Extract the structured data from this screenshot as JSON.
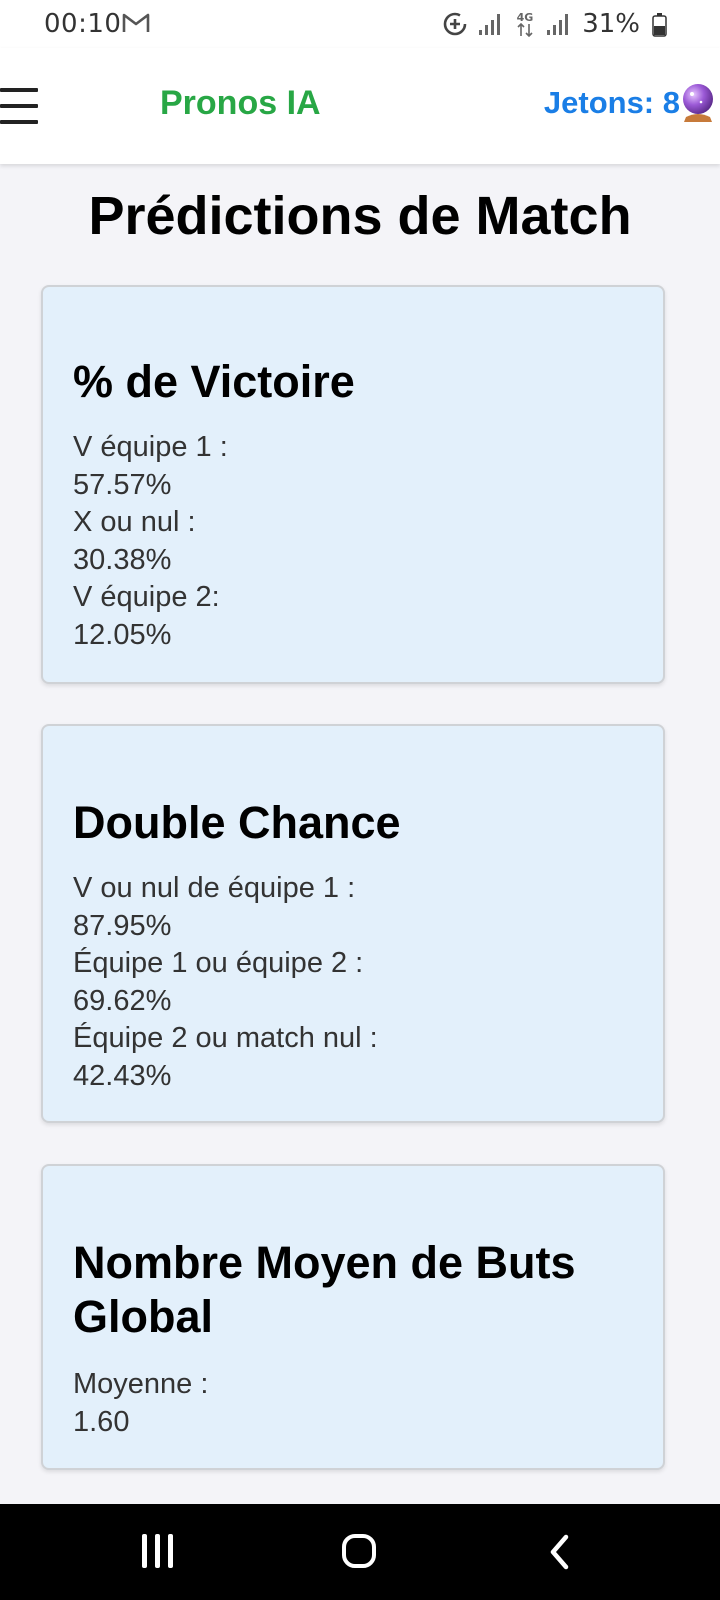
{
  "status_bar": {
    "time": "00:10",
    "battery_percent": "31%",
    "network_label": "4G",
    "icons": [
      "gmail-icon",
      "data-saver-icon",
      "signal-icon",
      "network-4g-icon",
      "signal-icon",
      "battery-icon"
    ]
  },
  "header": {
    "title": "Pronos IA",
    "tokens_label": "Jetons: 8",
    "menu_icon": "hamburger-menu-icon",
    "tokens_icon": "crystal-ball-icon",
    "title_color": "#28a745",
    "tokens_color": "#1a7ee6"
  },
  "page": {
    "title": "Prédictions de Match"
  },
  "cards": [
    {
      "title": "% de Victoire",
      "lines": [
        "V équipe 1 :",
        "57.57%",
        "X ou nul :",
        "30.38%",
        "V équipe 2:",
        "12.05%"
      ]
    },
    {
      "title": "Double Chance",
      "lines": [
        "V ou nul de équipe 1 :",
        "87.95%",
        "Équipe 1 ou équipe 2 :",
        "69.62%",
        "Équipe 2 ou match nul :",
        "42.43%"
      ]
    },
    {
      "title": "Nombre Moyen de Buts Global",
      "lines": [
        "Moyenne :",
        "1.60"
      ]
    }
  ],
  "nav_bar": {
    "icons": [
      "recent-apps-icon",
      "home-icon",
      "back-icon"
    ]
  }
}
